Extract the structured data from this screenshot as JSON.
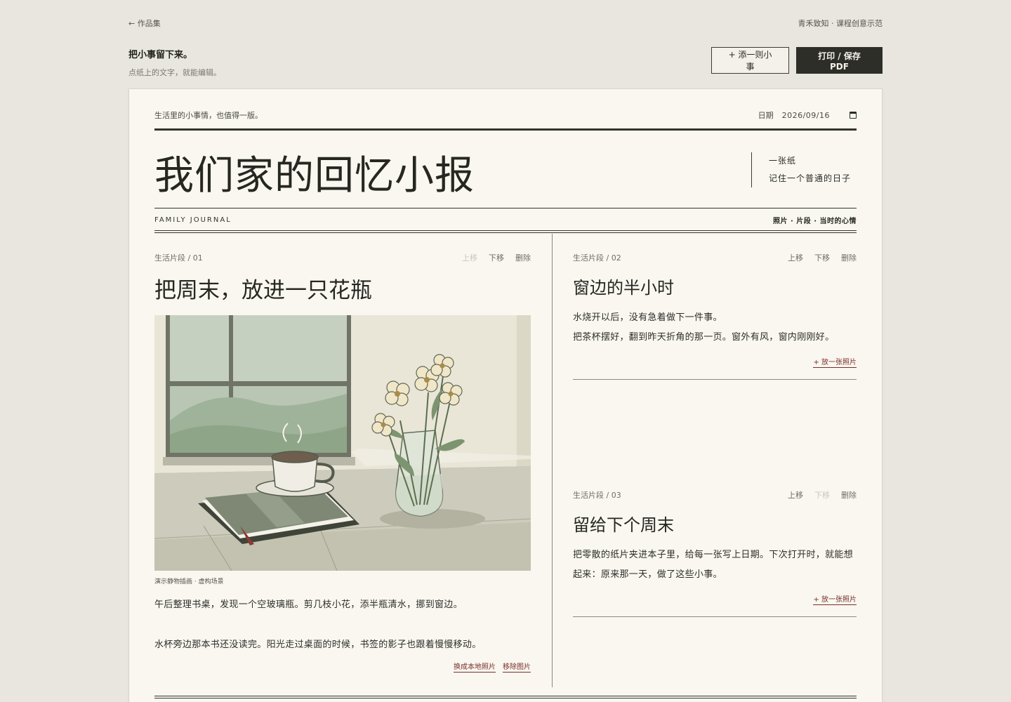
{
  "topbar": {
    "back_label": "← 作品集",
    "brand": "青禾致知 · 课程创意示范"
  },
  "hero": {
    "title": "把小事留下来。",
    "subtitle": "点纸上的文字，就能编辑。",
    "add_button": "+ 添一则小事",
    "print_button": "打印 / 保存 PDF"
  },
  "paper": {
    "motto": "生活里的小事情，也值得一版。",
    "date_label": "日期",
    "date_value": "2026/09/16",
    "title": "我们家的回忆小报",
    "tagline_1": "一张纸",
    "tagline_2": "记住一个普通的日子",
    "subtitle_en": "FAMILY JOURNAL",
    "subnav": "照片 · 片段 · 当时的心情"
  },
  "actions": {
    "up": "上移",
    "down": "下移",
    "delete": "删除",
    "add_photo": "+ 放一张照片",
    "replace_photo": "换成本地照片",
    "remove_photo": "移除图片"
  },
  "cards": [
    {
      "label": "生活片段 / 01",
      "title": "把周末，放进一只花瓶",
      "caption": "演示静物插画 · 虚构场景",
      "paragraphs": [
        "午后整理书桌，发现一个空玻璃瓶。剪几枝小花，添半瓶清水，挪到窗边。",
        "水杯旁边那本书还没读完。阳光走过桌面的时候，书签的影子也跟着慢慢移动。"
      ],
      "up_disabled": true,
      "down_disabled": false
    },
    {
      "label": "生活片段 / 02",
      "title": "窗边的半小时",
      "paragraphs": [
        "水烧开以后，没有急着做下一件事。",
        "把茶杯摆好，翻到昨天折角的那一页。窗外有风，窗内刚刚好。"
      ],
      "up_disabled": false,
      "down_disabled": false
    },
    {
      "label": "生活片段 / 03",
      "title": "留给下个周末",
      "paragraphs": [
        "把零散的纸片夹进本子里，给每一张写上日期。下次打开时，就能想起来：原来那一天，做了这些小事。"
      ],
      "up_disabled": false,
      "down_disabled": true
    }
  ],
  "colors": {
    "page_bg": "#e8e6df",
    "paper_bg": "#f9f7f0",
    "ink": "#2b2b26",
    "accent_red": "#7a2f2a",
    "sage": "#9aad92"
  },
  "icons": {
    "date_picker": "calendar-icon"
  }
}
